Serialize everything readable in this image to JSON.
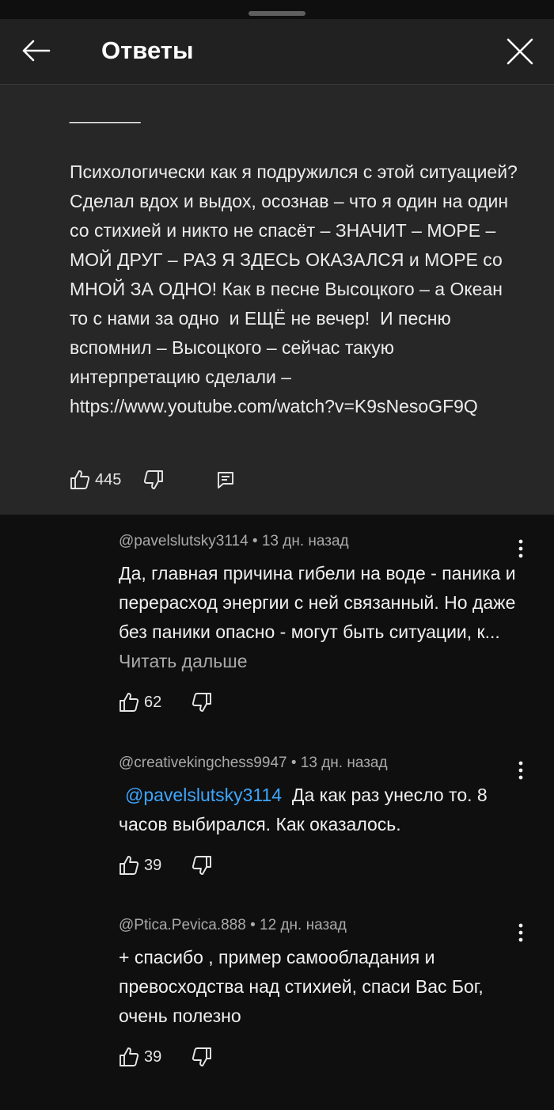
{
  "header": {
    "title": "Ответы"
  },
  "parent_comment": {
    "text": "_______\n\nПсихологически как я подружился с этой ситуацией? Сделал вдох и выдох, осознав – что я один на один со стихией и никто не спасёт – ЗНАЧИТ – МОРЕ – МОЙ ДРУГ – РАЗ Я ЗДЕСЬ ОКАЗАЛСЯ и МОРЕ со МНОЙ ЗА ОДНО! Как в песне Высоцкого – а Океан то с нами за одно  и ЕЩЁ не вечер!  И песню вспомнил – Высоцкого – сейчас такую интерпретацию сделали – https://www.youtube.com/watch?v=K9sNesoGF9Q",
    "likes": "445"
  },
  "replies": [
    {
      "author": "@pavelslutsky3114",
      "time": "13 дн. назад",
      "text": "Да, главная причина гибели на воде - паника и перерасход энергии с ней связанный. Но даже без паники опасно - могут быть ситуации, к...",
      "read_more": "Читать дальше",
      "likes": "62"
    },
    {
      "author": "@creativekingchess9947",
      "time": "13 дн. назад",
      "mention": "@pavelslutsky3114",
      "text": "Да как раз унесло то. 8 часов выбирался. Как оказалось.",
      "likes": "39"
    },
    {
      "author": "@Ptica.Pevica.888",
      "time": "12 дн. назад",
      "text": "+ спасибо , пример самообладания и превосходства над стихией, спаси Вас Бог, очень полезно",
      "likes": "39"
    }
  ],
  "icons": {
    "back": "arrow-left-icon",
    "close": "close-icon",
    "like": "thumbs-up-icon",
    "dislike": "thumbs-down-icon",
    "reply": "reply-comment-icon",
    "more": "more-vert-icon"
  },
  "colors": {
    "background": "#0f0f0f",
    "header": "#212121",
    "highlight": "#272727",
    "mention": "#3ea6ff",
    "secondary_text": "#aaaaaa"
  }
}
